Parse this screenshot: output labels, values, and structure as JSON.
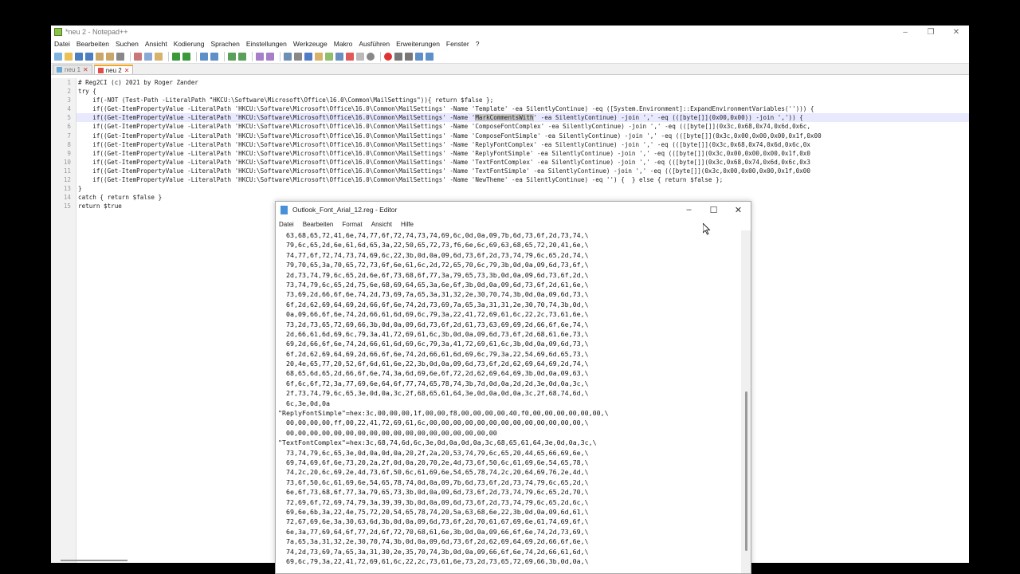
{
  "npp": {
    "title": "*neu 2 - Notepad++",
    "menu": [
      "Datei",
      "Bearbeiten",
      "Suchen",
      "Ansicht",
      "Kodierung",
      "Sprachen",
      "Einstellungen",
      "Werkzeuge",
      "Makro",
      "Ausführen",
      "Erweiterungen",
      "Fenster",
      "?"
    ],
    "tabs": [
      "neu 1",
      "neu 2"
    ],
    "line_numbers": [
      "1",
      "2",
      "3",
      "4",
      "5",
      "6",
      "7",
      "8",
      "9",
      "10",
      "11",
      "12",
      "13",
      "14",
      "15"
    ],
    "lines": [
      "# Reg2CI (c) 2021 by Roger Zander",
      "try {",
      "    if(-NOT (Test-Path -LiteralPath \"HKCU:\\Software\\Microsoft\\Office\\16.0\\Common\\MailSettings\")){ return $false };",
      "    if((Get-ItemPropertyValue -LiteralPath 'HKCU:\\Software\\Microsoft\\Office\\16.0\\Common\\MailSettings' -Name 'Template' -ea SilentlyContinue) -eq ([System.Environment]::ExpandEnvironmentVariables(''))) {",
      "    if((Get-ItemPropertyValue -LiteralPath 'HKCU:\\Software\\Microsoft\\Office\\16.0\\Common\\MailSettings' -Name '",
      "    if((Get-ItemPropertyValue -LiteralPath 'HKCU:\\Software\\Microsoft\\Office\\16.0\\Common\\MailSettings' -Name 'ComposeFontComplex' -ea SilentlyContinue) -join ',' -eq (([byte[]](0x3c,0x68,0x74,0x6d,0x6c,",
      "    if((Get-ItemPropertyValue -LiteralPath 'HKCU:\\Software\\Microsoft\\Office\\16.0\\Common\\MailSettings' -Name 'ComposeFontSimple' -ea SilentlyContinue) -join ',' -eq (([byte[]](0x3c,0x00,0x00,0x00,0x1f,0x00",
      "    if((Get-ItemPropertyValue -LiteralPath 'HKCU:\\Software\\Microsoft\\Office\\16.0\\Common\\MailSettings' -Name 'ReplyFontComplex' -ea SilentlyContinue) -join ',' -eq (([byte[]](0x3c,0x68,0x74,0x6d,0x6c,0x",
      "    if((Get-ItemPropertyValue -LiteralPath 'HKCU:\\Software\\Microsoft\\Office\\16.0\\Common\\MailSettings' -Name 'ReplyFontSimple' -ea SilentlyContinue) -join ',' -eq (([byte[]](0x3c,0x00,0x00,0x00,0x1f,0x0",
      "    if((Get-ItemPropertyValue -LiteralPath 'HKCU:\\Software\\Microsoft\\Office\\16.0\\Common\\MailSettings' -Name 'TextFontComplex' -ea SilentlyContinue) -join ',' -eq (([byte[]](0x3c,0x68,0x74,0x6d,0x6c,0x3",
      "    if((Get-ItemPropertyValue -LiteralPath 'HKCU:\\Software\\Microsoft\\Office\\16.0\\Common\\MailSettings' -Name 'TextFontSimple' -ea SilentlyContinue) -join ',' -eq (([byte[]](0x3c,0x00,0x00,0x00,0x1f,0x00",
      "    if((Get-ItemPropertyValue -LiteralPath 'HKCU:\\Software\\Microsoft\\Office\\16.0\\Common\\MailSettings' -Name 'NewTheme' -ea SilentlyContinue) -eq '') {  } else { return $false };",
      "}",
      "catch { return $false }",
      "return $true"
    ],
    "line5_highlight": "MarkCommentsWith",
    "line5_rest": "' -ea SilentlyContinue) -join ',' -eq (([byte[]](0x00,0x00)) -join ',')) {"
  },
  "editor": {
    "title": "Outlook_Font_Arial_12.reg - Editor",
    "menu": [
      "Datei",
      "Bearbeiten",
      "Format",
      "Ansicht",
      "Hilfe"
    ],
    "lines": [
      "  63,68,65,72,41,6e,74,77,6f,72,74,73,74,69,6c,0d,0a,09,7b,6d,73,6f,2d,73,74,\\",
      "  79,6c,65,2d,6e,61,6d,65,3a,22,50,65,72,73,f6,6e,6c,69,63,68,65,72,20,41,6e,\\",
      "  74,77,6f,72,74,73,74,69,6c,22,3b,0d,0a,09,6d,73,6f,2d,73,74,79,6c,65,2d,74,\\",
      "  79,70,65,3a,70,65,72,73,6f,6e,61,6c,2d,72,65,70,6c,79,3b,0d,0a,09,6d,73,6f,\\",
      "  2d,73,74,79,6c,65,2d,6e,6f,73,68,6f,77,3a,79,65,73,3b,0d,0a,09,6d,73,6f,2d,\\",
      "  73,74,79,6c,65,2d,75,6e,68,69,64,65,3a,6e,6f,3b,0d,0a,09,6d,73,6f,2d,61,6e,\\",
      "  73,69,2d,66,6f,6e,74,2d,73,69,7a,65,3a,31,32,2e,30,70,74,3b,0d,0a,09,6d,73,\\",
      "  6f,2d,62,69,64,69,2d,66,6f,6e,74,2d,73,69,7a,65,3a,31,31,2e,30,70,74,3b,0d,\\",
      "  0a,09,66,6f,6e,74,2d,66,61,6d,69,6c,79,3a,22,41,72,69,61,6c,22,2c,73,61,6e,\\",
      "  73,2d,73,65,72,69,66,3b,0d,0a,09,6d,73,6f,2d,61,73,63,69,69,2d,66,6f,6e,74,\\",
      "  2d,66,61,6d,69,6c,79,3a,41,72,69,61,6c,3b,0d,0a,09,6d,73,6f,2d,68,61,6e,73,\\",
      "  69,2d,66,6f,6e,74,2d,66,61,6d,69,6c,79,3a,41,72,69,61,6c,3b,0d,0a,09,6d,73,\\",
      "  6f,2d,62,69,64,69,2d,66,6f,6e,74,2d,66,61,6d,69,6c,79,3a,22,54,69,6d,65,73,\\",
      "  20,4e,65,77,20,52,6f,6d,61,6e,22,3b,0d,0a,09,6d,73,6f,2d,62,69,64,69,2d,74,\\",
      "  68,65,6d,65,2d,66,6f,6e,74,3a,6d,69,6e,6f,72,2d,62,69,64,69,3b,0d,0a,09,63,\\",
      "  6f,6c,6f,72,3a,77,69,6e,64,6f,77,74,65,78,74,3b,7d,0d,0a,2d,2d,3e,0d,0a,3c,\\",
      "  2f,73,74,79,6c,65,3e,0d,0a,3c,2f,68,65,61,64,3e,0d,0a,0d,0a,3c,2f,68,74,6d,\\",
      "  6c,3e,0d,0a",
      "\"ReplyFontSimple\"=hex:3c,00,00,00,1f,00,00,f8,00,00,00,00,40,f0,00,00,00,00,00,00,\\",
      "  00,00,00,00,ff,00,22,41,72,69,61,6c,00,00,00,00,00,00,00,00,00,00,00,00,00,\\",
      "  00,00,00,00,00,00,00,00,00,00,00,00,00,00,00,00,00,00",
      "\"TextFontComplex\"=hex:3c,68,74,6d,6c,3e,0d,0a,0d,0a,3c,68,65,61,64,3e,0d,0a,3c,\\",
      "  73,74,79,6c,65,3e,0d,0a,0d,0a,20,2f,2a,20,53,74,79,6c,65,20,44,65,66,69,6e,\\",
      "  69,74,69,6f,6e,73,20,2a,2f,0d,0a,20,70,2e,4d,73,6f,50,6c,61,69,6e,54,65,78,\\",
      "  74,2c,20,6c,69,2e,4d,73,6f,50,6c,61,69,6e,54,65,78,74,2c,20,64,69,76,2e,4d,\\",
      "  73,6f,50,6c,61,69,6e,54,65,78,74,0d,0a,09,7b,6d,73,6f,2d,73,74,79,6c,65,2d,\\",
      "  6e,6f,73,68,6f,77,3a,79,65,73,3b,0d,0a,09,6d,73,6f,2d,73,74,79,6c,65,2d,70,\\",
      "  72,69,6f,72,69,74,79,3a,39,39,3b,0d,0a,09,6d,73,6f,2d,73,74,79,6c,65,2d,6c,\\",
      "  69,6e,6b,3a,22,4e,75,72,20,54,65,78,74,20,5a,63,68,6e,22,3b,0d,0a,09,6d,61,\\",
      "  72,67,69,6e,3a,30,63,6d,3b,0d,0a,09,6d,73,6f,2d,70,61,67,69,6e,61,74,69,6f,\\",
      "  6e,3a,77,69,64,6f,77,2d,6f,72,70,68,61,6e,3b,0d,0a,09,66,6f,6e,74,2d,73,69,\\",
      "  7a,65,3a,31,32,2e,30,70,74,3b,0d,0a,09,6d,73,6f,2d,62,69,64,69,2d,66,6f,6e,\\",
      "  74,2d,73,69,7a,65,3a,31,30,2e,35,70,74,3b,0d,0a,09,66,6f,6e,74,2d,66,61,6d,\\",
      "  69,6c,79,3a,22,41,72,69,61,6c,22,2c,73,61,6e,73,2d,73,65,72,69,66,3b,0d,0a,\\"
    ]
  }
}
